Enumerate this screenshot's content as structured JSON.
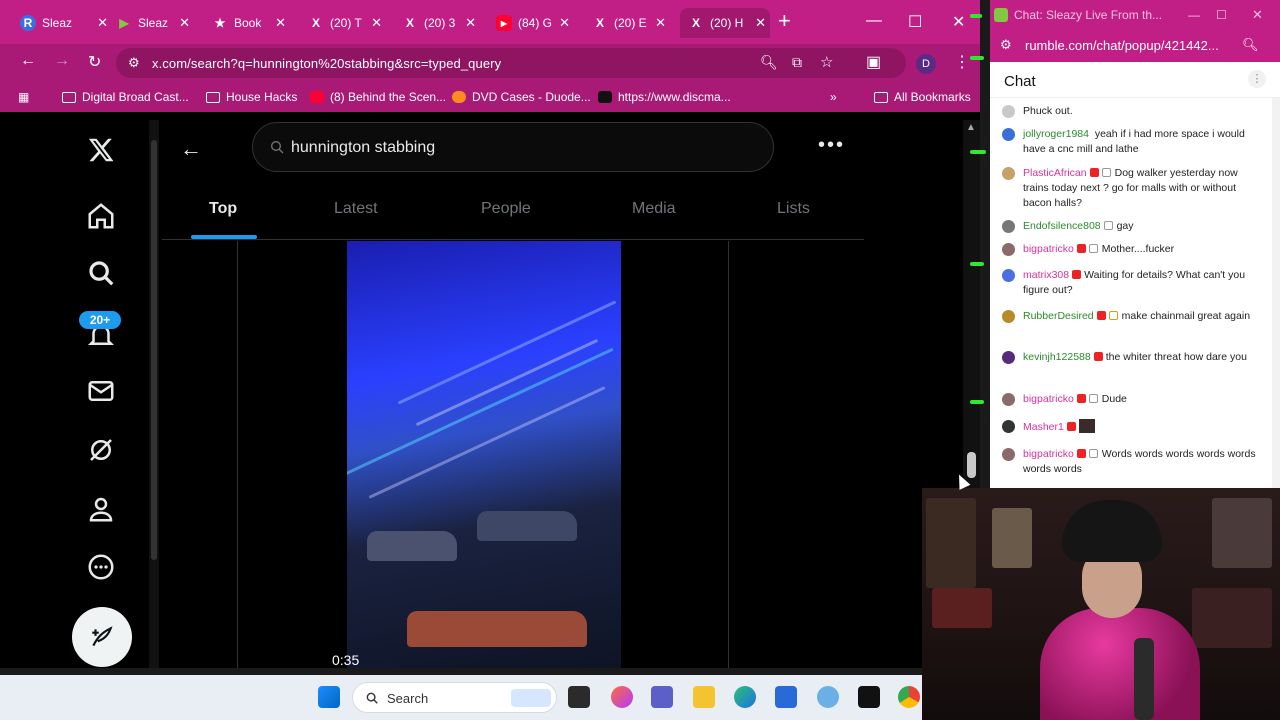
{
  "browser": {
    "tabs": [
      {
        "label": "Sleaz",
        "icon": "R"
      },
      {
        "label": "Sleaz",
        "icon": "▶"
      },
      {
        "label": "Book",
        "icon": "★"
      },
      {
        "label": "(20) T",
        "icon": "X"
      },
      {
        "label": "(20) 3",
        "icon": "X"
      },
      {
        "label": "(84) G",
        "icon": "▶"
      },
      {
        "label": "(20) E",
        "icon": "X"
      },
      {
        "label": "(20) H",
        "icon": "X"
      }
    ],
    "url": "x.com/search?q=hunnington%20stabbing&src=typed_query",
    "bookmarks": [
      "Digital Broad Cast...",
      "House Hacks",
      "(8) Behind the Scen...",
      "DVD Cases - Duode...",
      "https://www.discma...",
      "All Bookmarks"
    ],
    "colors": {
      "chrome": "#c21f86",
      "accent": "#1d9bf0"
    }
  },
  "x": {
    "notif_badge": "20+",
    "search_query": "hunnington stabbing",
    "tabs": [
      "Top",
      "Latest",
      "People",
      "Media",
      "Lists"
    ],
    "video_time": "0:35",
    "nav_icons": [
      "x-logo-icon",
      "home-icon",
      "search-icon",
      "bell-icon",
      "mail-icon",
      "grok-icon",
      "profile-icon",
      "more-icon",
      "post-icon"
    ]
  },
  "chat": {
    "window_title": "Chat: Sleazy Live From th...",
    "url": "rumble.com/chat/popup/421442...",
    "header": "Chat",
    "messages": [
      {
        "user": "",
        "text": "Phuck out.",
        "color": "#222",
        "av": "#c9c9c9"
      },
      {
        "user": "jollyroger1984",
        "text": "yeah if i had more space i would have a cnc mill and lathe",
        "color": "#2d8a2d",
        "av": "#3a6fd8"
      },
      {
        "user": "PlasticAfrican",
        "text": "Dog walker yesterday now trains today next ? go for malls with or without bacon halls?",
        "color": "#d6339b",
        "av": "#c7a06a"
      },
      {
        "user": "Endofsilence808",
        "text": "gay",
        "color": "#2d8a2d",
        "av": "#777"
      },
      {
        "user": "bigpatricko",
        "text": "Mother....fucker",
        "color": "#d6339b",
        "av": "#8a6a6a"
      },
      {
        "user": "matrix308",
        "text": "Waiting for details? What can't you figure out?",
        "color": "#d6339b",
        "av": "#4a6fe0"
      },
      {
        "user": "RubberDesired",
        "text": "make chainmail great again",
        "color": "#2d8a2d",
        "av": "#b88a2a"
      },
      {
        "user": "kevinjh122588",
        "text": "the whiter threat how dare you",
        "color": "#2d8a2d",
        "av": "#5a2a7a"
      },
      {
        "user": "bigpatricko",
        "text": "Dude",
        "color": "#d6339b",
        "av": "#8a6a6a"
      },
      {
        "user": "Masher1",
        "text": "",
        "color": "#d6339b",
        "av": "#333"
      },
      {
        "user": "bigpatricko",
        "text": "Words words words words words words words",
        "color": "#d6339b",
        "av": "#8a6a6a"
      }
    ]
  },
  "taskbar": {
    "search_label": "Search"
  }
}
